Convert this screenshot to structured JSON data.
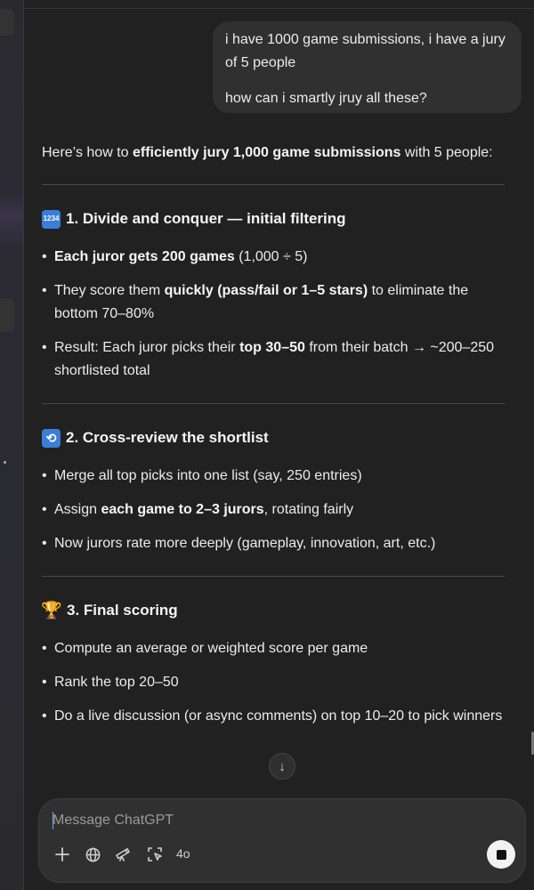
{
  "user_message": {
    "line1": "i have 1000 game submissions, i have a jury of 5 people",
    "line2": "how can i smartly jruy all these?"
  },
  "answer": {
    "intro": {
      "pre": "Here’s how to ",
      "bold": "efficiently jury 1,000 game submissions",
      "post": " with 5 people:"
    },
    "sections": [
      {
        "icon": "input-numbers-emoji",
        "title": "1. Divide and conquer — initial filtering",
        "bullets": [
          {
            "b1": "Each juror gets 200 games",
            "t1": " (1,000 ÷ 5)"
          },
          {
            "t0": "They score them ",
            "b1": "quickly (pass/fail or 1–5 stars)",
            "t1": " to eliminate the bottom 70–80%"
          },
          {
            "t0": "Result: Each juror picks their ",
            "b1": "top 30–50",
            "t1": " from their batch → ~200–250 shortlisted total"
          }
        ]
      },
      {
        "icon": "repeat-emoji",
        "title": "2. Cross-review the shortlist",
        "bullets": [
          {
            "t0": "Merge all top picks into one list (say, 250 entries)"
          },
          {
            "t0": "Assign ",
            "b1": "each game to 2–3 jurors",
            "t1": ", rotating fairly"
          },
          {
            "t0": "Now jurors rate more deeply (gameplay, innovation, art, etc.)"
          }
        ]
      },
      {
        "icon": "trophy-emoji",
        "title": "3. Final scoring",
        "bullets": [
          {
            "t0": "Compute an average or weighted score per game"
          },
          {
            "t0": "Rank the top 20–50"
          },
          {
            "t0": "Do a live discussion (or async comments) on top 10–20 to pick winners"
          }
        ]
      }
    ]
  },
  "composer": {
    "placeholder": "Message ChatGPT",
    "model": "4o",
    "tools": [
      "plus-icon",
      "globe-icon",
      "telescope-icon",
      "sparkle-select-icon"
    ]
  },
  "colors": {
    "background": "#212121",
    "bubble": "#303030",
    "text": "#ececec",
    "send_button": "#f2f2f2"
  }
}
